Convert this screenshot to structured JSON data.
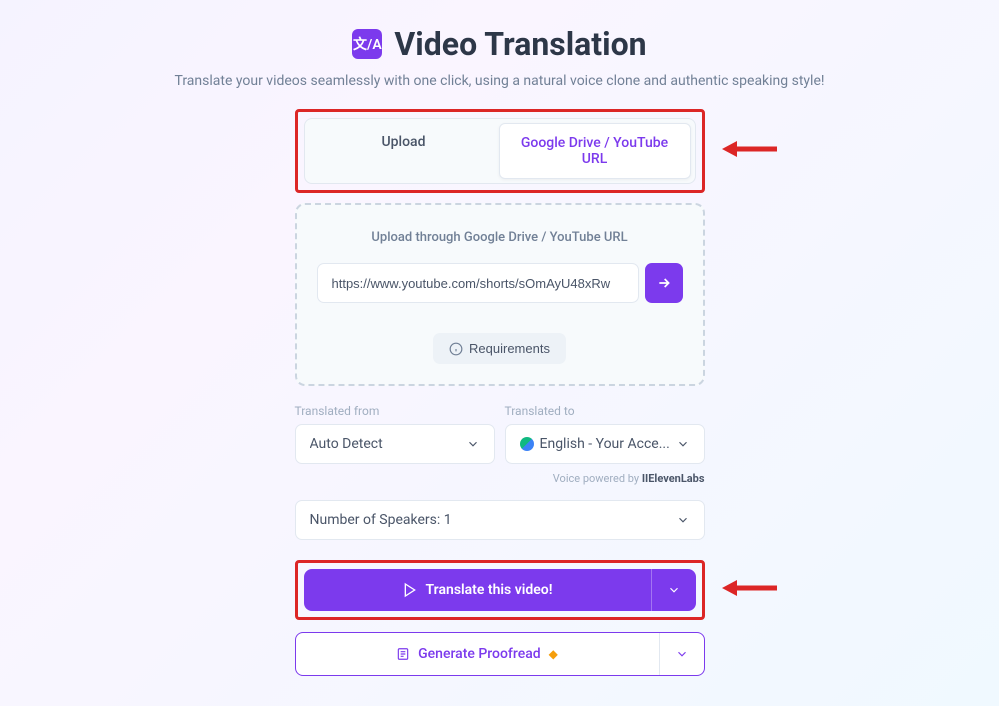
{
  "title": "Video Translation",
  "subtitle": "Translate your videos seamlessly with one click, using a natural voice clone and authentic speaking style!",
  "tabs": {
    "upload": "Upload",
    "url": "Google Drive / YouTube URL"
  },
  "upload_area": {
    "label": "Upload through Google Drive / YouTube URL",
    "url_value": "https://www.youtube.com/shorts/sOmAyU48xRw",
    "requirements": "Requirements"
  },
  "lang": {
    "from_label": "Translated from",
    "from_value": "Auto Detect",
    "to_label": "Translated to",
    "to_value": "English - Your Acce..."
  },
  "voice_credit_prefix": "Voice powered by ",
  "voice_credit_brand": "IIElevenLabs",
  "speakers": "Number of Speakers: 1",
  "translate_btn": "Translate this video!",
  "proofread_btn": "Generate Proofread"
}
